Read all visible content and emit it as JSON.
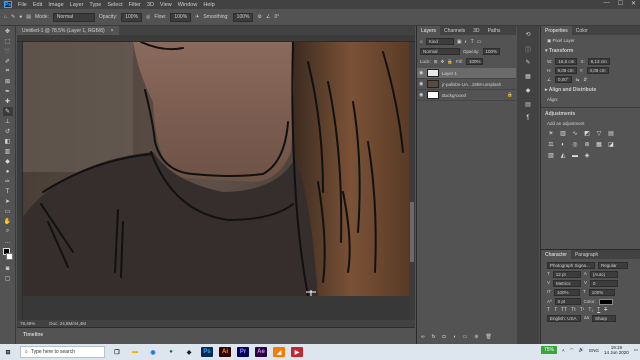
{
  "menu": [
    "File",
    "Edit",
    "Image",
    "Layer",
    "Type",
    "Select",
    "Filter",
    "3D",
    "View",
    "Window",
    "Help"
  ],
  "window_controls": [
    "—",
    "☐",
    "✕"
  ],
  "options": {
    "mode_label": "Mode:",
    "mode_value": "Normal",
    "opacity_label": "Opacity:",
    "opacity_value": "100%",
    "flow_label": "Flow:",
    "flow_value": "100%",
    "smoothing_label": "Smoothing:",
    "smoothing_value": "100%",
    "angle_value": "0°"
  },
  "document": {
    "tab_title": "Untitled-1 @ 78,5% (Layer 1, RGB/8)",
    "close": "×",
    "zoom": "78,49%",
    "doc_size": "Doc: 24,8M/44,4M"
  },
  "timeline": {
    "label": "Timeline"
  },
  "layers_panel": {
    "tabs": [
      "Layers",
      "Channels",
      "3D",
      "Paths"
    ],
    "filter_value": "Kind",
    "blend_value": "Normal",
    "opacity_label": "Opacity:",
    "opacity_value": "100%",
    "lock_label": "Lock:",
    "fill_label": "Fill:",
    "fill_value": "100%",
    "layers": [
      {
        "name": "Layer 1",
        "selected": true
      },
      {
        "name": "jr-palisbn-UA...19b8-unsplash",
        "selected": false
      },
      {
        "name": "Background",
        "selected": false
      }
    ]
  },
  "properties_panel": {
    "tabs": [
      "Properties",
      "Color"
    ],
    "kind": "Pixel Layer",
    "transform_title": "Transform",
    "w_label": "W:",
    "w_value": "16,6 cm",
    "h_label": "H:",
    "h_value": "9,08 cm",
    "x_label": "X:",
    "x_value": "6,13 cm",
    "y_label": "Y:",
    "y_value": "4,08 cm",
    "angle_value": "0,00°",
    "align_title": "Align and Distribute",
    "align_label": "Align:",
    "adjustments_title": "Adjustments",
    "adjustments_sub": "Add an adjustment"
  },
  "character_panel": {
    "tabs": [
      "Character",
      "Paragraph"
    ],
    "font_family": "Photograph Signa...",
    "font_style": "Regular",
    "font_size": "12 pt",
    "leading": "(Auto)",
    "kerning": "Metrics",
    "tracking": "0",
    "vscale": "100%",
    "hscale": "100%",
    "baseline": "0 pt",
    "color_label": "Color:",
    "language": "English: USA",
    "aa_label": "aa",
    "aa_value": "Sharp"
  },
  "taskbar": {
    "search_placeholder": "Type here to search",
    "battery": "75%",
    "language": "ENG",
    "time": "19:19",
    "date": "14 Jun 2020"
  }
}
